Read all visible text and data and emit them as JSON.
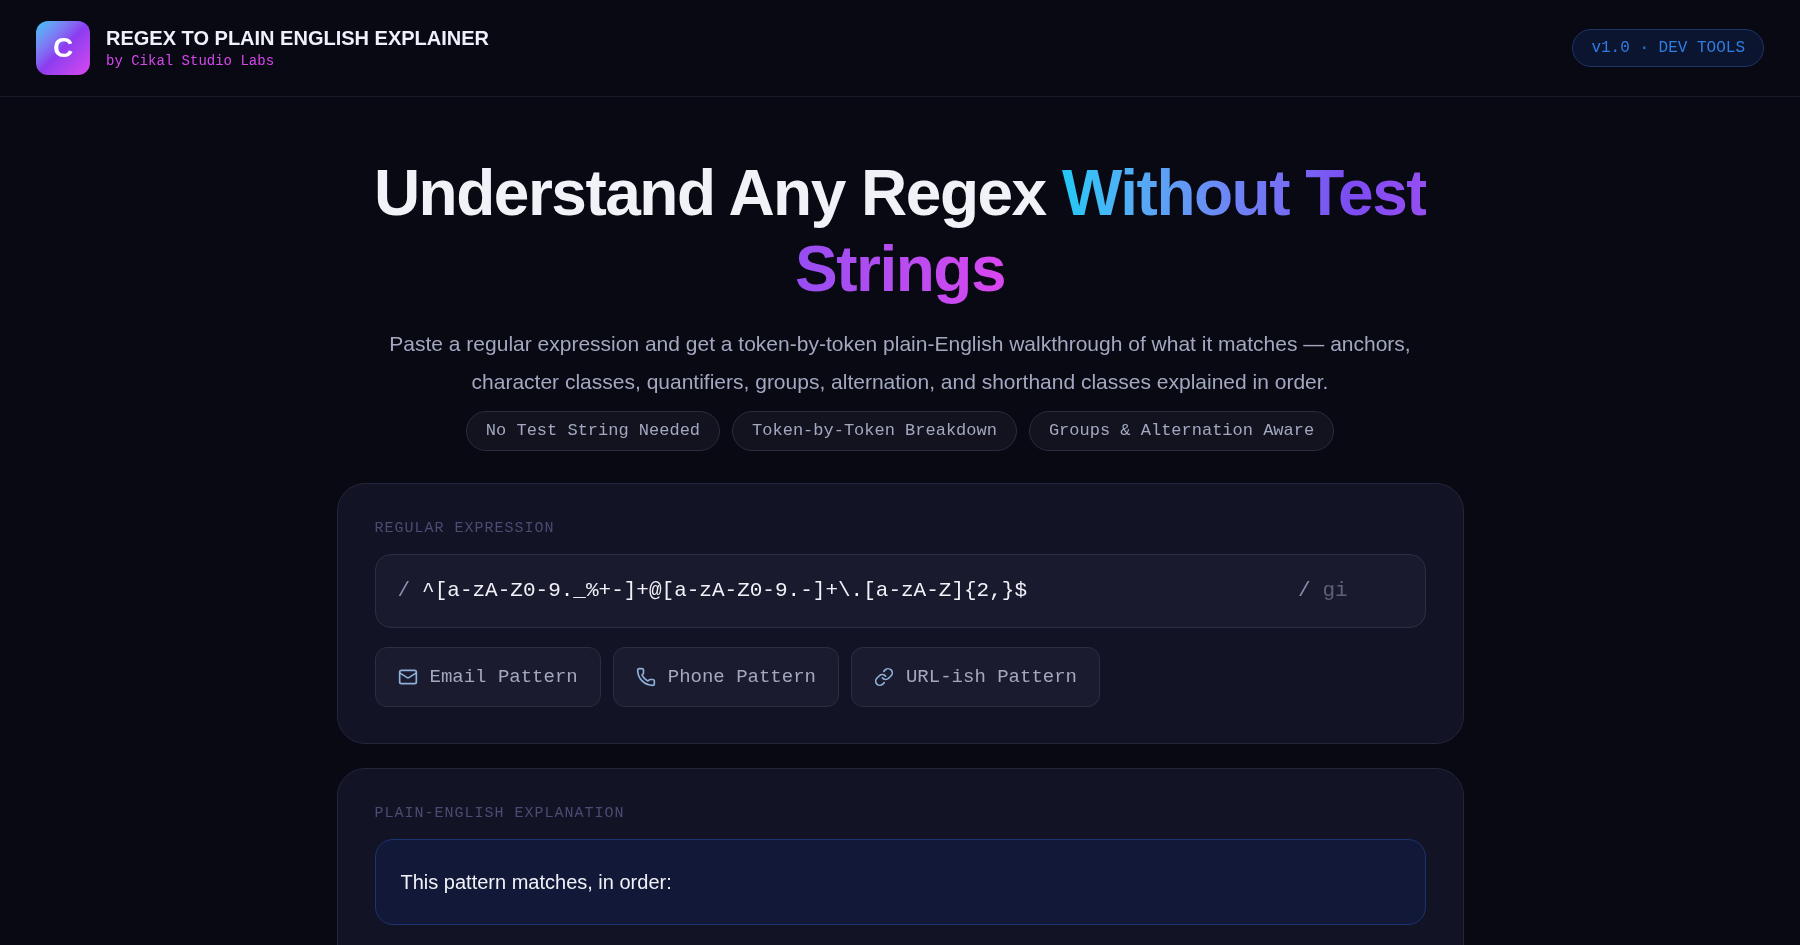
{
  "header": {
    "logo_letter": "C",
    "title": "REGEX TO PLAIN ENGLISH EXPLAINER",
    "subtitle": "by Cikal Studio Labs",
    "badge": "v1.0 · DEV TOOLS"
  },
  "hero": {
    "title_plain": "Understand Any Regex ",
    "title_accent": "Without Test Strings",
    "description": "Paste a regular expression and get a token-by-token plain-English walkthrough of what it matches — anchors, character classes, quantifiers, groups, alternation, and shorthand classes explained in order.",
    "tags": [
      "No Test String Needed",
      "Token-by-Token Breakdown",
      "Groups & Alternation Aware"
    ]
  },
  "regex_card": {
    "label": "REGULAR EXPRESSION",
    "open_slash": "/",
    "pattern": "^[a-zA-Z0-9._%+-]+@[a-zA-Z0-9.-]+\\.[a-zA-Z]{2,}$",
    "close_slash": "/",
    "flags_placeholder": "gi",
    "presets": [
      {
        "kind": "mail",
        "label": "Email Pattern"
      },
      {
        "kind": "phone",
        "label": "Phone Pattern"
      },
      {
        "kind": "link",
        "label": "URL-ish Pattern"
      }
    ]
  },
  "explanation_card": {
    "label": "PLAIN-ENGLISH EXPLANATION",
    "intro": "This pattern matches, in order:"
  }
}
